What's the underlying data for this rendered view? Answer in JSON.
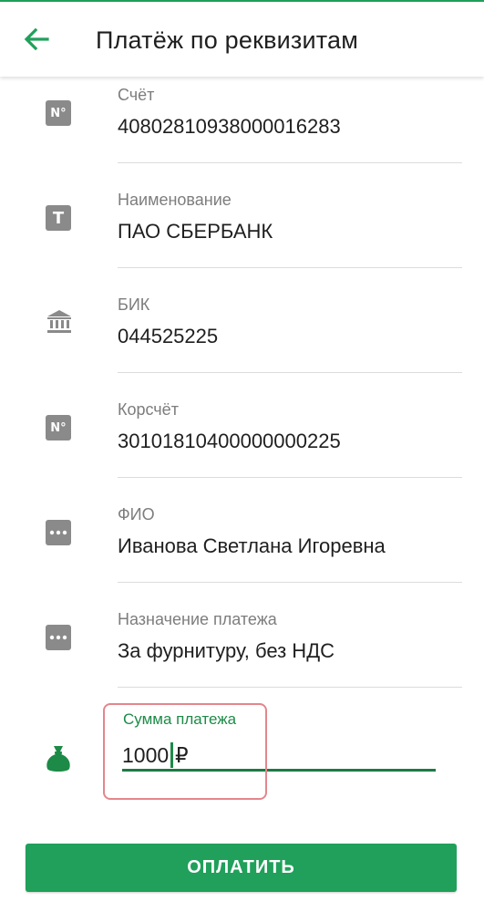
{
  "header": {
    "title": "Платёж по реквизитам"
  },
  "fields": [
    {
      "label": "Счёт",
      "value": "40802810938000016283",
      "icon": "number-icon"
    },
    {
      "label": "Наименование",
      "value": "ПАО СБЕРБАНК",
      "icon": "text-icon"
    },
    {
      "label": "БИК",
      "value": "044525225",
      "icon": "bank-icon"
    },
    {
      "label": "Корсчёт",
      "value": "30101810400000000225",
      "icon": "number-icon"
    },
    {
      "label": "ФИО",
      "value": "Иванова Светлана Игоревна",
      "icon": "more-icon"
    },
    {
      "label": "Назначение платежа",
      "value": "За фурнитуру, без НДС",
      "icon": "more-icon"
    }
  ],
  "glyphs": {
    "number": "N°",
    "text": "T"
  },
  "amount": {
    "label": "Сумма платежа",
    "value": "1000",
    "currency": "₽",
    "icon": "money-bag-icon"
  },
  "pay_button": {
    "label": "ОПЛАТИТЬ"
  },
  "colors": {
    "accent": "#20a05a",
    "accent_dark": "#1d7a44",
    "icon_gray": "#8a8a8a",
    "label_gray": "#7d7d7d",
    "highlight": "#e4868c"
  }
}
